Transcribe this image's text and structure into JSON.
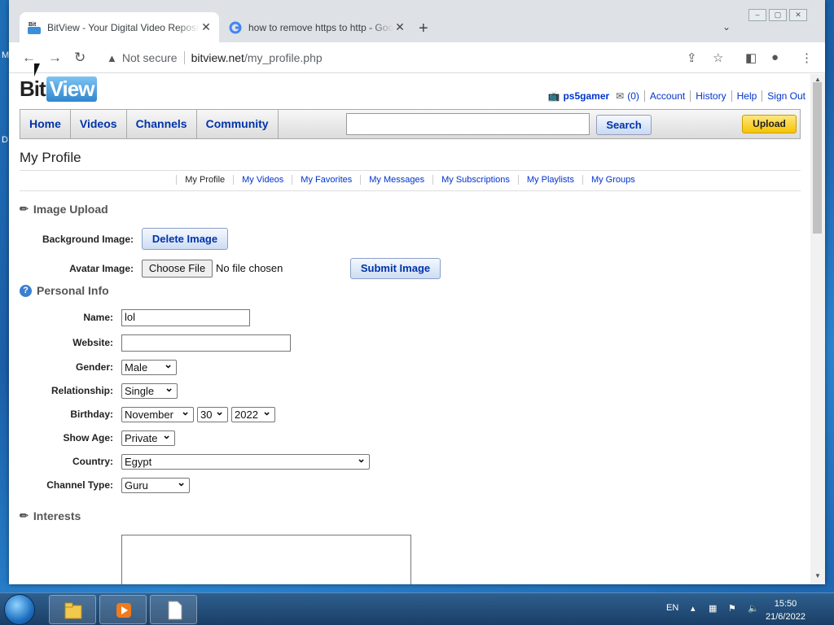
{
  "desktop": {
    "left_text_1": "M",
    "left_text_2": "D"
  },
  "browser": {
    "tabs": [
      {
        "title": "BitView - Your Digital Video Repository",
        "active": true
      },
      {
        "title": "how to remove https to http - Google Search",
        "active": false
      }
    ],
    "security_label": "Not secure",
    "url_host": "bitview.net",
    "url_path": "/my_profile.php"
  },
  "site": {
    "logo_bit": "Bit",
    "logo_view": "View",
    "username": "ps5gamer",
    "mail_count": "(0)",
    "user_links": [
      "Account",
      "History",
      "Help",
      "Sign Out"
    ],
    "nav": [
      "Home",
      "Videos",
      "Channels",
      "Community"
    ],
    "search_value": "",
    "search_button": "Search",
    "upload_button": "Upload",
    "page_title": "My Profile",
    "subnav": [
      "My Profile",
      "My Videos",
      "My Favorites",
      "My Messages",
      "My Subscriptions",
      "My Playlists",
      "My Groups"
    ]
  },
  "image_upload": {
    "heading": "Image Upload",
    "background_label": "Background Image:",
    "delete_button": "Delete Image",
    "avatar_label": "Avatar Image:",
    "choose_file": "Choose File",
    "no_file": "No file chosen",
    "submit_button": "Submit Image"
  },
  "personal_info": {
    "heading": "Personal Info",
    "name_label": "Name:",
    "name_value": "lol",
    "website_label": "Website:",
    "website_value": "",
    "gender_label": "Gender:",
    "gender_value": "Male",
    "relationship_label": "Relationship:",
    "relationship_value": "Single",
    "birthday_label": "Birthday:",
    "birthday_month": "November",
    "birthday_day": "30",
    "birthday_year": "2022",
    "show_age_label": "Show Age:",
    "show_age_value": "Private",
    "country_label": "Country:",
    "country_value": "Egypt",
    "channel_type_label": "Channel Type:",
    "channel_type_value": "Guru"
  },
  "interests": {
    "heading": "Interests",
    "value": ""
  },
  "taskbar": {
    "lang": "EN",
    "time": "15:50",
    "date": "21/6/2022"
  }
}
